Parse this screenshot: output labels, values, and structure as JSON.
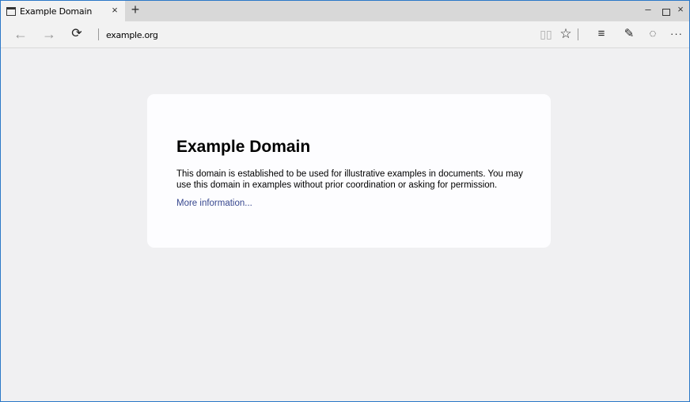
{
  "tab": {
    "title": "Example Domain",
    "close": "×"
  },
  "new_tab": "+",
  "window_controls": {
    "minimize": "–",
    "close": "×"
  },
  "nav": {
    "back": "←",
    "forward": "→",
    "refresh": "⟳",
    "address": "example.org"
  },
  "toolbar": {
    "reading_view": "▯▯",
    "favorite": "☆",
    "hub": "≡",
    "web_note": "✎",
    "share": "◌",
    "more": "···"
  },
  "page": {
    "heading": "Example Domain",
    "paragraph": "This domain is established to be used for illustrative examples in documents. You may use this domain in examples without prior coordination or asking for permission.",
    "link": "More information..."
  },
  "icons": {
    "tab_icon": "page-icon",
    "back": "back-arrow-icon",
    "forward": "forward-arrow-icon",
    "refresh": "refresh-icon",
    "reading_view": "reading-view-icon",
    "favorite": "star-icon",
    "hub": "hub-icon",
    "web_note": "web-note-icon",
    "share": "share-icon",
    "more": "more-icon"
  },
  "colors": {
    "window_border": "#2b78c8",
    "link": "#38488f",
    "page_bg": "#f0f0f2",
    "card_bg": "#fdfdff"
  }
}
